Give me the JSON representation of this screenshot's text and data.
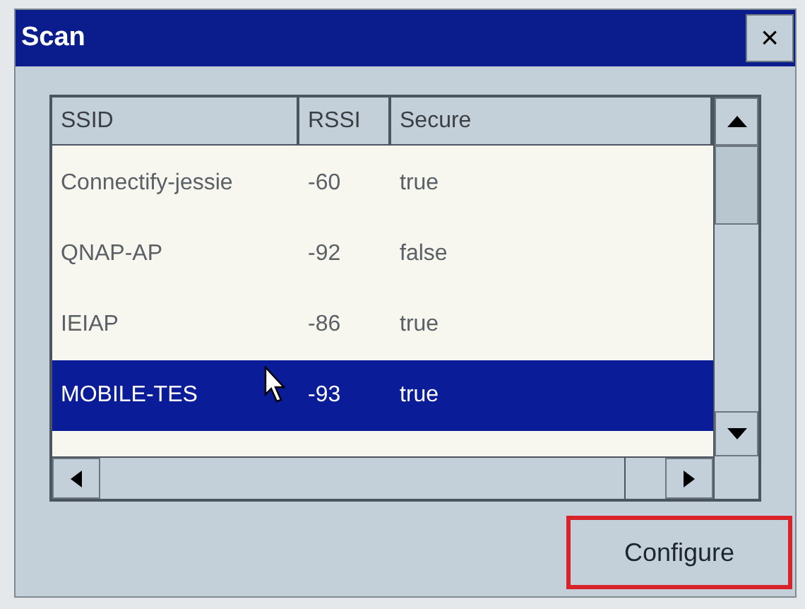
{
  "window": {
    "title": "Scan",
    "close": "×"
  },
  "table": {
    "columns": [
      "SSID",
      "RSSI",
      "Secure"
    ],
    "rows": [
      {
        "cells": [
          "Connectify-jessie",
          "-60",
          "true"
        ],
        "selected": false
      },
      {
        "cells": [
          "QNAP-AP",
          "-92",
          "false"
        ],
        "selected": false
      },
      {
        "cells": [
          "IEIAP",
          "-86",
          "true"
        ],
        "selected": false
      },
      {
        "cells": [
          "MOBILE-TES",
          "-93",
          "true"
        ],
        "selected": true
      }
    ]
  },
  "buttons": [
    {
      "label": "Configure",
      "highlighted": true
    }
  ]
}
